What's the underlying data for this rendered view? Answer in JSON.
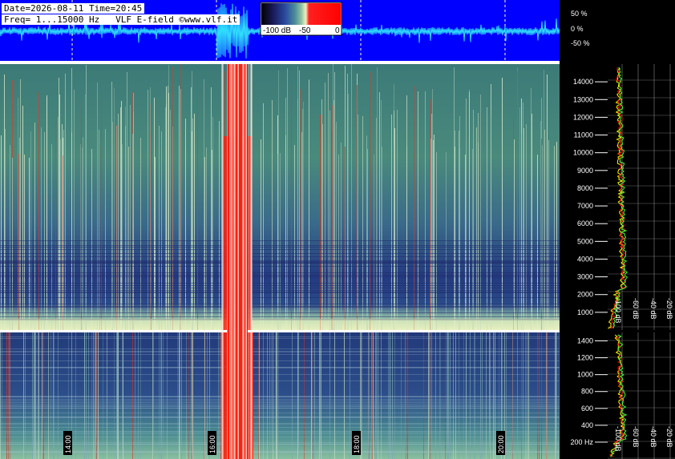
{
  "header": {
    "line1": "Date=2026-08-11 Time=20:45",
    "line2": "Freq= 1...15000 Hz   VLF E-field ©www.vlf.it"
  },
  "colorbar": {
    "labels": [
      "-100 dB",
      "-50",
      "0"
    ],
    "colors": [
      "#000000",
      "#1a1a5a",
      "#2a4aa0",
      "#4a8a9a",
      "#8ac0a0",
      "#f0f0c0",
      "#ff2020"
    ]
  },
  "waveform": {
    "labels": [
      "50 %",
      "0 %",
      "-50 %"
    ],
    "background": "#0000ff",
    "trace_color": "#30e0ff"
  },
  "chart_data": [
    {
      "type": "heatmap",
      "name": "upper-spectrogram",
      "ylim": [
        0,
        15000
      ],
      "yticks": [
        1000,
        2000,
        3000,
        4000,
        5000,
        6000,
        7000,
        8000,
        9000,
        10000,
        11000,
        12000,
        13000,
        14000
      ],
      "ytick_labels": [
        "1000",
        "2000",
        "3000",
        "4000",
        "5000",
        "6000",
        "7000",
        "8000",
        "9000",
        "10000",
        "11000",
        "12000",
        "13000",
        "14000"
      ]
    },
    {
      "type": "heatmap",
      "name": "lower-spectrogram",
      "ylim": [
        0,
        1500
      ],
      "yticks": [
        200,
        400,
        600,
        800,
        1000,
        1200,
        1400
      ],
      "ytick_labels": [
        "200 Hz",
        "400",
        "600",
        "800",
        "1000",
        "1200",
        "1400"
      ],
      "time_labels": [
        "14:00",
        "16:00",
        "18:00",
        "20:00"
      ]
    },
    {
      "type": "line",
      "name": "upper-spectrum-profile",
      "xtick_labels": [
        "-100 dB",
        "-60 dB",
        "-40 dB",
        "-20 dB"
      ],
      "series_colors": [
        "#ffff00",
        "#ff0000",
        "#40ff40"
      ]
    },
    {
      "type": "line",
      "name": "lower-spectrum-profile",
      "xtick_labels": [
        "-100 dB",
        "-60 dB",
        "-40 dB",
        "-20 dB"
      ],
      "series_colors": [
        "#ffff00",
        "#ff0000",
        "#40ff40"
      ]
    }
  ]
}
